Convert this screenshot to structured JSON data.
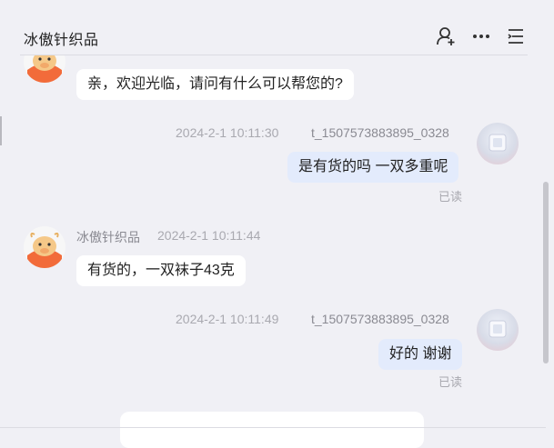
{
  "header": {
    "title": "冰傲针织品",
    "icons": [
      "user-add-icon",
      "more-icon",
      "menu-icon"
    ]
  },
  "messages": [
    {
      "side": "left",
      "text": "亲，欢迎光临，请问有什么可以帮您的?"
    },
    {
      "side": "right",
      "sender": "t_1507573883895_0328",
      "time": "2024-2-1 10:11:30",
      "text": "是有货的吗 一双多重呢",
      "status": "已读"
    },
    {
      "side": "left",
      "sender": "冰傲针织品",
      "time": "2024-2-1 10:11:44",
      "text": "有货的，一双袜子43克"
    },
    {
      "side": "right",
      "sender": "t_1507573883895_0328",
      "time": "2024-2-1 10:11:49",
      "text": "好的 谢谢",
      "status": "已读"
    }
  ],
  "colors": {
    "background": "#f0f0f5",
    "bubble_user": "#e3ebfc",
    "bubble_seller": "#ffffff",
    "seller_avatar": "#f26b3a"
  }
}
